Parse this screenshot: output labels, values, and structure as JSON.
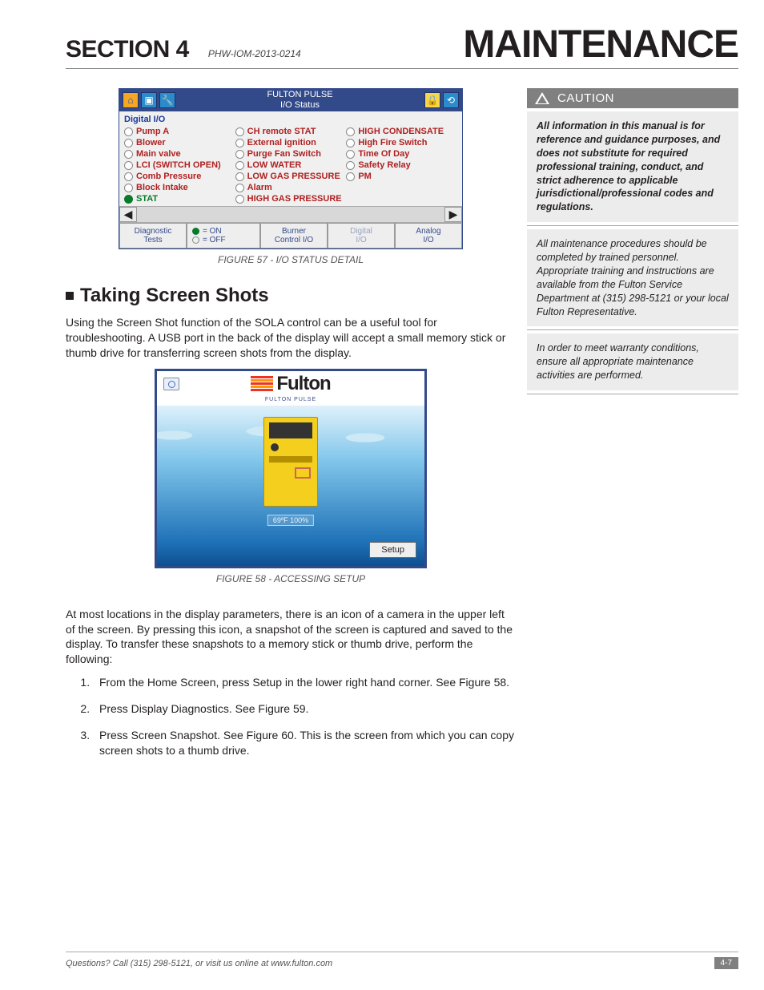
{
  "header": {
    "section": "SECTION 4",
    "doc": "PHW-IOM-2013-0214",
    "title": "MAINTENANCE"
  },
  "fig57": {
    "title_l1": "FULTON PULSE",
    "title_l2": "I/O Status",
    "group": "Digital I/O",
    "items": [
      {
        "t": "Pump A",
        "on": false
      },
      {
        "t": "CH remote STAT",
        "on": false
      },
      {
        "t": "HIGH CONDENSATE",
        "on": false
      },
      {
        "t": "Blower",
        "on": false
      },
      {
        "t": "External ignition",
        "on": false
      },
      {
        "t": "High Fire Switch",
        "on": false
      },
      {
        "t": "Main valve",
        "on": false
      },
      {
        "t": "Purge Fan Switch",
        "on": false
      },
      {
        "t": "Time Of Day",
        "on": false
      },
      {
        "t": "LCI (SWITCH OPEN)",
        "on": false
      },
      {
        "t": "LOW WATER",
        "on": false
      },
      {
        "t": "Safety Relay",
        "on": false
      },
      {
        "t": "Comb Pressure",
        "on": false
      },
      {
        "t": "LOW GAS PRESSURE",
        "on": false
      },
      {
        "t": "PM",
        "on": false
      },
      {
        "t": "Block Intake",
        "on": false
      },
      {
        "t": "Alarm",
        "on": false
      },
      {
        "t": "",
        "on": false,
        "blank": true
      },
      {
        "t": "STAT",
        "on": true
      },
      {
        "t": "HIGH GAS PRESSURE",
        "on": false
      },
      {
        "t": "",
        "on": false,
        "blank": true
      }
    ],
    "tabs": [
      "Diagnostic\nTests",
      "Burner\nControl I/O",
      "Digital\nI/O",
      "Analog\nI/O"
    ],
    "legend_on": "= ON",
    "legend_off": "= OFF",
    "caption": "FIGURE 57 - I/O STATUS DETAIL"
  },
  "subheading": "Taking Screen Shots",
  "para1": "Using the Screen Shot function of the SOLA control can be a useful tool for troubleshooting.  A USB port in the back of the display will accept a small memory stick or thumb drive for transferring screen shots from the display.",
  "fig58": {
    "brand": "Fulton",
    "sub": "FULTON PULSE",
    "under": "69ºF  100%",
    "setup": "Setup",
    "caption": "FIGURE 58 - ACCESSING SETUP"
  },
  "para2": "At most locations in the display parameters, there is an icon of a camera in the upper left of the screen.  By pressing this icon, a snapshot of the screen is captured and saved to the display.  To transfer these snapshots to a memory stick or thumb drive, perform the following:",
  "steps": [
    "From the Home Screen, press Setup in the lower right hand corner. See Figure 58.",
    "Press Display Diagnostics. See Figure 59.",
    "Press Screen Snapshot.  See Figure 60. This is the screen from which you can copy screen shots to a thumb drive."
  ],
  "caution": {
    "head": "CAUTION",
    "b1": "All information in this manual is for reference and guidance purposes, and does not substitute for required professional training, conduct, and strict adherence to applicable jurisdictional/professional codes and regulations.",
    "b2": "All maintenance procedures should be completed by trained personnel. Appropriate training and instructions are available from the  Fulton Service Department at (315) 298-5121 or your local Fulton Representative.",
    "b3": "In order to meet warranty conditions, ensure all appropriate maintenance activities are performed."
  },
  "footer": {
    "q": "Questions?  Call (315) 298-5121, or visit us online at  www.fulton.com",
    "page": "4-7"
  }
}
